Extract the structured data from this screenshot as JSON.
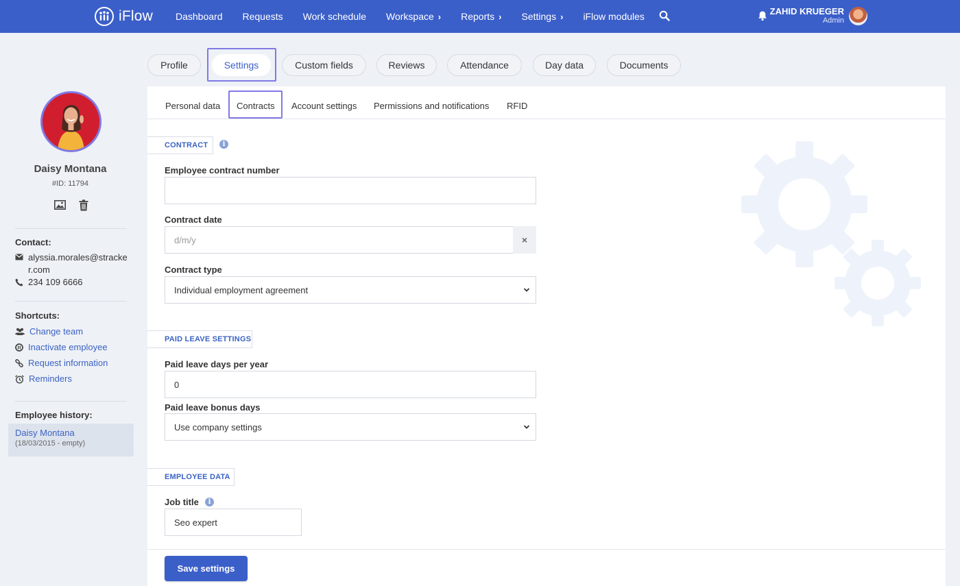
{
  "brand": {
    "name": "iFlow"
  },
  "nav": {
    "items": [
      {
        "label": "Dashboard",
        "chevron": false
      },
      {
        "label": "Requests",
        "chevron": false
      },
      {
        "label": "Work schedule",
        "chevron": false
      },
      {
        "label": "Workspace",
        "chevron": true
      },
      {
        "label": "Reports",
        "chevron": true
      },
      {
        "label": "Settings",
        "chevron": true
      },
      {
        "label": "iFlow modules",
        "chevron": false
      }
    ],
    "chevron_glyph": "›"
  },
  "user": {
    "name": "ZAHID KRUEGER",
    "role": "Admin"
  },
  "employee": {
    "name": "Daisy Montana",
    "id": "#ID: 11794",
    "contact_heading": "Contact:",
    "email": "alyssia.morales@stracker.com",
    "phone": "234 109 6666",
    "shortcuts_heading": "Shortcuts:",
    "shortcuts": [
      "Change team",
      "Inactivate employee",
      "Request information",
      "Reminders"
    ],
    "history_heading": "Employee history:",
    "history": {
      "name": "Daisy Montana",
      "period": "(18/03/2015 - empty)"
    }
  },
  "tabs": [
    "Profile",
    "Settings",
    "Custom fields",
    "Reviews",
    "Attendance",
    "Day data",
    "Documents"
  ],
  "active_tab": "Settings",
  "subtabs": [
    "Personal data",
    "Contracts",
    "Account settings",
    "Permissions and notifications",
    "RFID"
  ],
  "active_subtab": "Contracts",
  "form": {
    "contract_section": "CONTRACT",
    "contract_number_label": "Employee contract number",
    "contract_number_value": "",
    "contract_date_label": "Contract date",
    "contract_date_placeholder": "d/m/y",
    "clear_glyph": "×",
    "contract_type_label": "Contract type",
    "contract_type_value": "Individual employment agreement",
    "paid_leave_section": "PAID LEAVE SETTINGS",
    "paid_leave_days_label": "Paid leave days per year",
    "paid_leave_days_value": "0",
    "bonus_days_label": "Paid leave bonus days",
    "bonus_days_value": "Use company settings",
    "employee_data_section": "EMPLOYEE DATA",
    "job_title_label": "Job title",
    "job_title_value": "Seo expert",
    "info_glyph": "i",
    "save_label": "Save settings"
  },
  "colors": {
    "brand": "#3b5fc9",
    "focus": "#7f79e5",
    "link": "#3b63c2",
    "background": "#eef1f6"
  }
}
